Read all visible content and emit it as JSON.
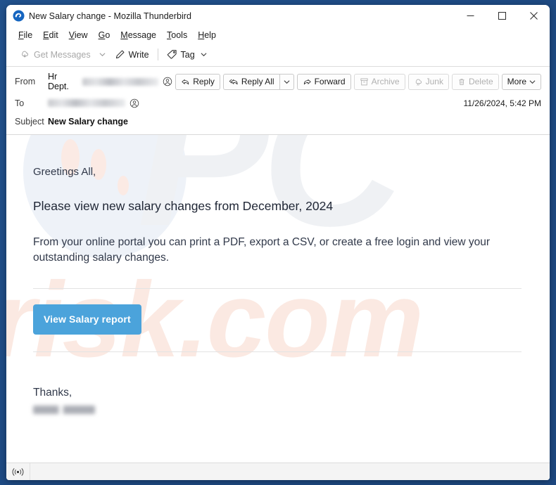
{
  "window": {
    "title": "New Salary change - Mozilla Thunderbird",
    "app_icon": "thunderbird-icon",
    "controls": {
      "minimize": "minimize-icon",
      "maximize": "maximize-icon",
      "close": "close-icon"
    }
  },
  "menubar": [
    {
      "label": "File",
      "accesskey": "F",
      "rest": "ile"
    },
    {
      "label": "Edit",
      "accesskey": "E",
      "rest": "dit"
    },
    {
      "label": "View",
      "accesskey": "V",
      "rest": "iew"
    },
    {
      "label": "Go",
      "accesskey": "G",
      "rest": "o"
    },
    {
      "label": "Message",
      "accesskey": "M",
      "rest": "essage"
    },
    {
      "label": "Tools",
      "accesskey": "T",
      "rest": "ools"
    },
    {
      "label": "Help",
      "accesskey": "H",
      "rest": "elp"
    }
  ],
  "toolbar": {
    "get_messages": "Get Messages",
    "get_messages_enabled": false,
    "write": "Write",
    "tag": "Tag"
  },
  "message_header": {
    "from_label": "From",
    "from_name": "Hr Dept.",
    "from_address_redacted": true,
    "to_label": "To",
    "to_address_redacted": true,
    "subject_label": "Subject",
    "subject": "New Salary change",
    "date": "11/26/2024, 5:42 PM"
  },
  "actions": [
    {
      "label": "Reply",
      "icon": "reply-icon",
      "enabled": true,
      "split": false
    },
    {
      "label": "Reply All",
      "icon": "reply-all-icon",
      "enabled": true,
      "split": true
    },
    {
      "label": "Forward",
      "icon": "forward-icon",
      "enabled": true,
      "split": false
    },
    {
      "label": "Archive",
      "icon": "archive-icon",
      "enabled": false,
      "split": false
    },
    {
      "label": "Junk",
      "icon": "junk-icon",
      "enabled": false,
      "split": false
    },
    {
      "label": "Delete",
      "icon": "trash-icon",
      "enabled": false,
      "split": false
    },
    {
      "label": "More",
      "icon": "chevron-down-icon",
      "enabled": true,
      "split": false
    }
  ],
  "body": {
    "greeting": "Greetings All,",
    "headline": "Please view new salary changes from December, 2024",
    "paragraph": "From your online portal you can print a PDF, export a CSV, or create a free login and view your outstanding salary changes.",
    "cta_label": "View Salary report",
    "cta_color": "#4ba3db",
    "closing": "Thanks,",
    "signature_redacted": true
  },
  "watermark": {
    "text_top": "PC",
    "text_bottom": "risk.com",
    "color_bottom": "#fbe9e2",
    "color_top": "#eff1f4"
  },
  "statusbar": {
    "icon": "broadcast-icon"
  }
}
